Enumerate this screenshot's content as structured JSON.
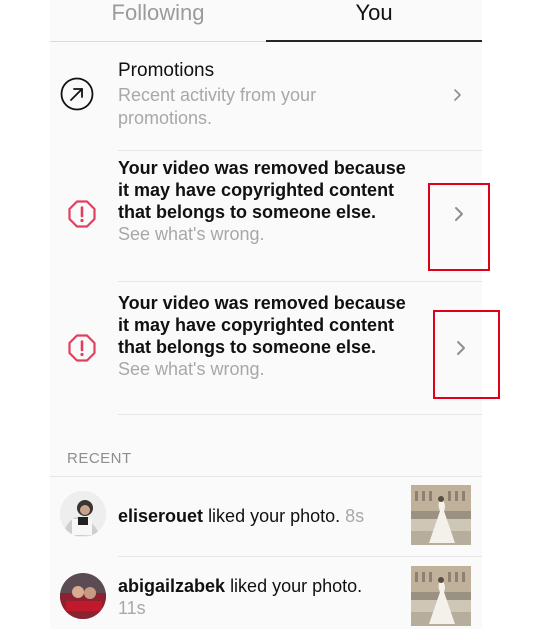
{
  "tabs": {
    "following": "Following",
    "you": "You"
  },
  "promotions": {
    "title": "Promotions",
    "subtitle": "Recent activity from your promotions.",
    "icon": "arrow-up-right-circle-icon"
  },
  "notifications": [
    {
      "message": "Your video was removed because it may have copyrighted content that belongs to someone else.",
      "link": "See what's wrong.",
      "icon": "alert-icon"
    },
    {
      "message": "Your video was removed because it may have copyrighted content that belongs to someone else.",
      "link": "See what's wrong.",
      "icon": "alert-icon"
    }
  ],
  "recent": {
    "header": "RECENT",
    "items": [
      {
        "user": "eliserouet",
        "action": "liked your photo.",
        "time": "8s"
      },
      {
        "user": "abigailzabek",
        "action": "liked your photo.",
        "time": "11s"
      }
    ]
  },
  "colors": {
    "alert": "#e0405e",
    "annotation_box": "#e0001a",
    "muted_text": "#a8a8a8"
  }
}
